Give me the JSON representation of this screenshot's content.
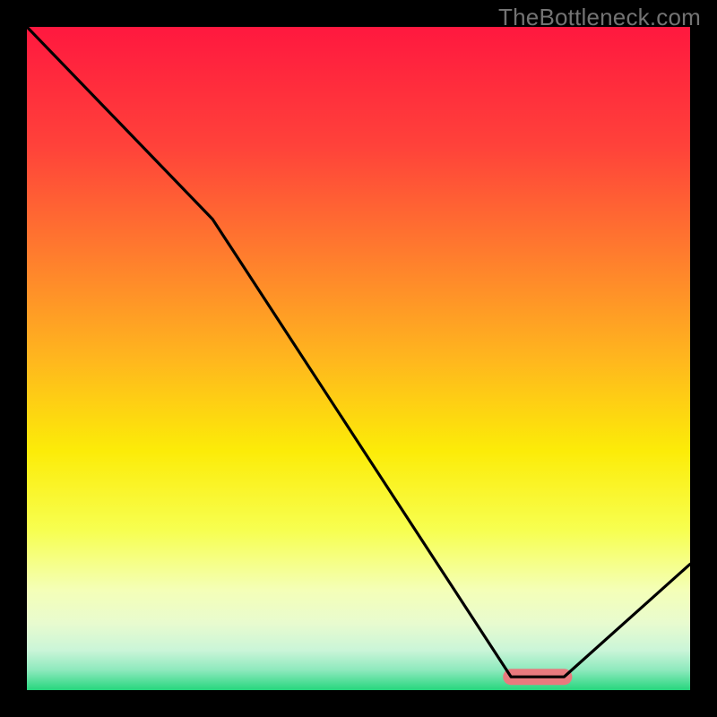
{
  "watermark": "TheBottleneck.com",
  "chart_data": {
    "type": "line",
    "title": "",
    "xlabel": "",
    "ylabel": "",
    "xlim": [
      0,
      100
    ],
    "ylim": [
      0,
      100
    ],
    "x": [
      0,
      28,
      73,
      81,
      100
    ],
    "values": [
      100,
      71,
      2,
      2,
      19
    ],
    "gradient_stops": [
      {
        "offset": 0,
        "color": "#ff183f"
      },
      {
        "offset": 18,
        "color": "#ff423a"
      },
      {
        "offset": 34,
        "color": "#ff7b2e"
      },
      {
        "offset": 50,
        "color": "#ffb61e"
      },
      {
        "offset": 64,
        "color": "#fcec08"
      },
      {
        "offset": 76,
        "color": "#f7ff51"
      },
      {
        "offset": 85,
        "color": "#f4ffb8"
      },
      {
        "offset": 90,
        "color": "#e8fbcf"
      },
      {
        "offset": 94,
        "color": "#caf5d8"
      },
      {
        "offset": 97,
        "color": "#8de9bd"
      },
      {
        "offset": 100,
        "color": "#26d67d"
      }
    ],
    "highlight": {
      "x_start": 73,
      "x_end": 81,
      "color": "#e87a7e"
    }
  }
}
